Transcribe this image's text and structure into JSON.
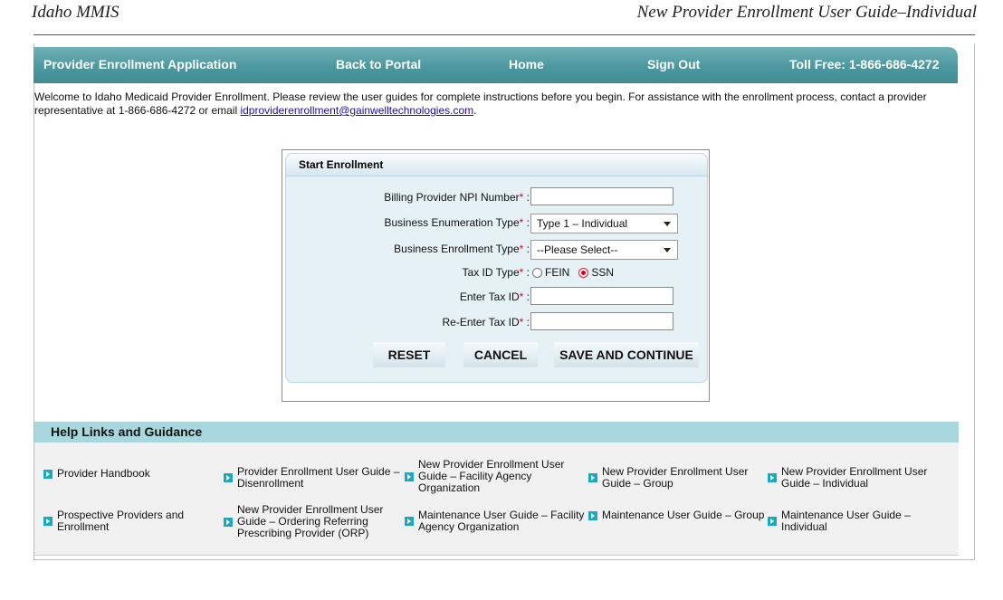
{
  "doc_header": {
    "left": "Idaho MMIS",
    "right": "New Provider Enrollment User Guide–Individual"
  },
  "nav": {
    "title": "Provider Enrollment Application",
    "back": "Back to Portal",
    "home": "Home",
    "signout": "Sign Out",
    "tollfree": "Toll Free: 1-866-686-4272"
  },
  "welcome": {
    "text": "Welcome to Idaho Medicaid Provider Enrollment. Please review the user guides for complete instructions before you begin. For assistance with the enrollment process, contact a provider representative at 1-866-686-4272 or email ",
    "email": "idproviderenrollment@gainwelltechnologies.com",
    "end": "."
  },
  "enrollment": {
    "title": "Start Enrollment",
    "npi_label": "Billing Provider NPI Number",
    "bet_label": "Business Enumeration Type",
    "bet_value": "Type 1 – Individual",
    "bent_label": "Business Enrollment Type",
    "bent_value": "--Please Select--",
    "taxid_type_label": "Tax ID Type",
    "fein": "FEIN",
    "ssn": "SSN",
    "selected_taxid_type": "SSN",
    "taxid_label": "Enter Tax ID",
    "retaxid_label": "Re-Enter Tax ID",
    "required_mark": "*",
    "colon": " :",
    "reset": "RESET",
    "cancel": "CANCEL",
    "save": "SAVE AND CONTINUE"
  },
  "help": {
    "title": "Help Links and Guidance",
    "links": [
      "Provider Handbook",
      "Provider Enrollment User Guide – Disenrollment",
      "New Provider Enrollment User Guide – Facility Agency Organization",
      "New Provider Enrollment User Guide – Group",
      "New Provider Enrollment User Guide – Individual",
      "Prospective Providers and Enrollment",
      "New Provider Enrollment User Guide – Ordering Referring Prescribing Provider (ORP)",
      "Maintenance User Guide – Facility Agency Organization",
      "Maintenance User Guide – Group",
      "Maintenance User Guide – Individual"
    ],
    "icon": "arrow-right-icon"
  },
  "colors": {
    "nav": "#4f9aa0",
    "help_header": "#a8d8de",
    "required": "#e0001b",
    "link_arrow": "#1aa7c2"
  }
}
